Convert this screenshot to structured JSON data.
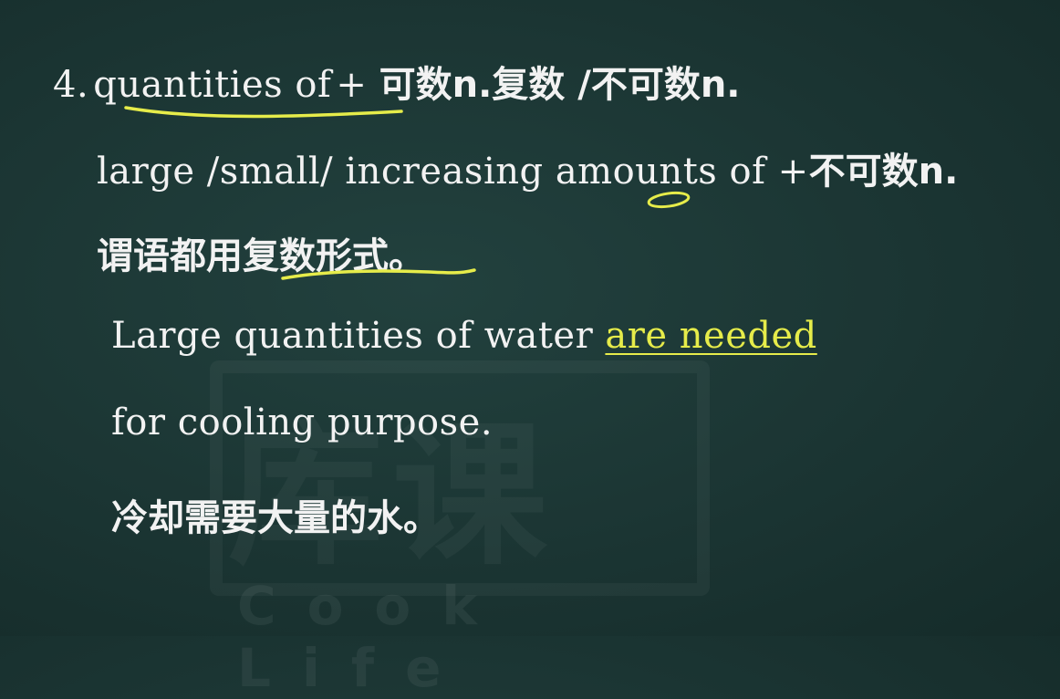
{
  "slide": {
    "line1": {
      "number": "4.",
      "phrase": "quantities of",
      "rest_en": " + ",
      "rest_zh": "可数n.复数 /不可数n."
    },
    "line2": {
      "part1": "large /small/ increasing amounts of +",
      "part2_zh": "不可数n."
    },
    "line3": {
      "zh": "谓语都用复数形式。"
    },
    "example": {
      "prefix": "Large quantities of water ",
      "highlight": "are needed",
      "line2": "for cooling purpose.",
      "translation": "冷却需要大量的水。"
    }
  },
  "watermark": {
    "logo_chars": "库课",
    "text": "Cook Life"
  },
  "colors": {
    "background": "#1b3533",
    "text": "#f2f2f2",
    "highlight": "#e6ec4a",
    "annotation": "#e6ec4a"
  }
}
